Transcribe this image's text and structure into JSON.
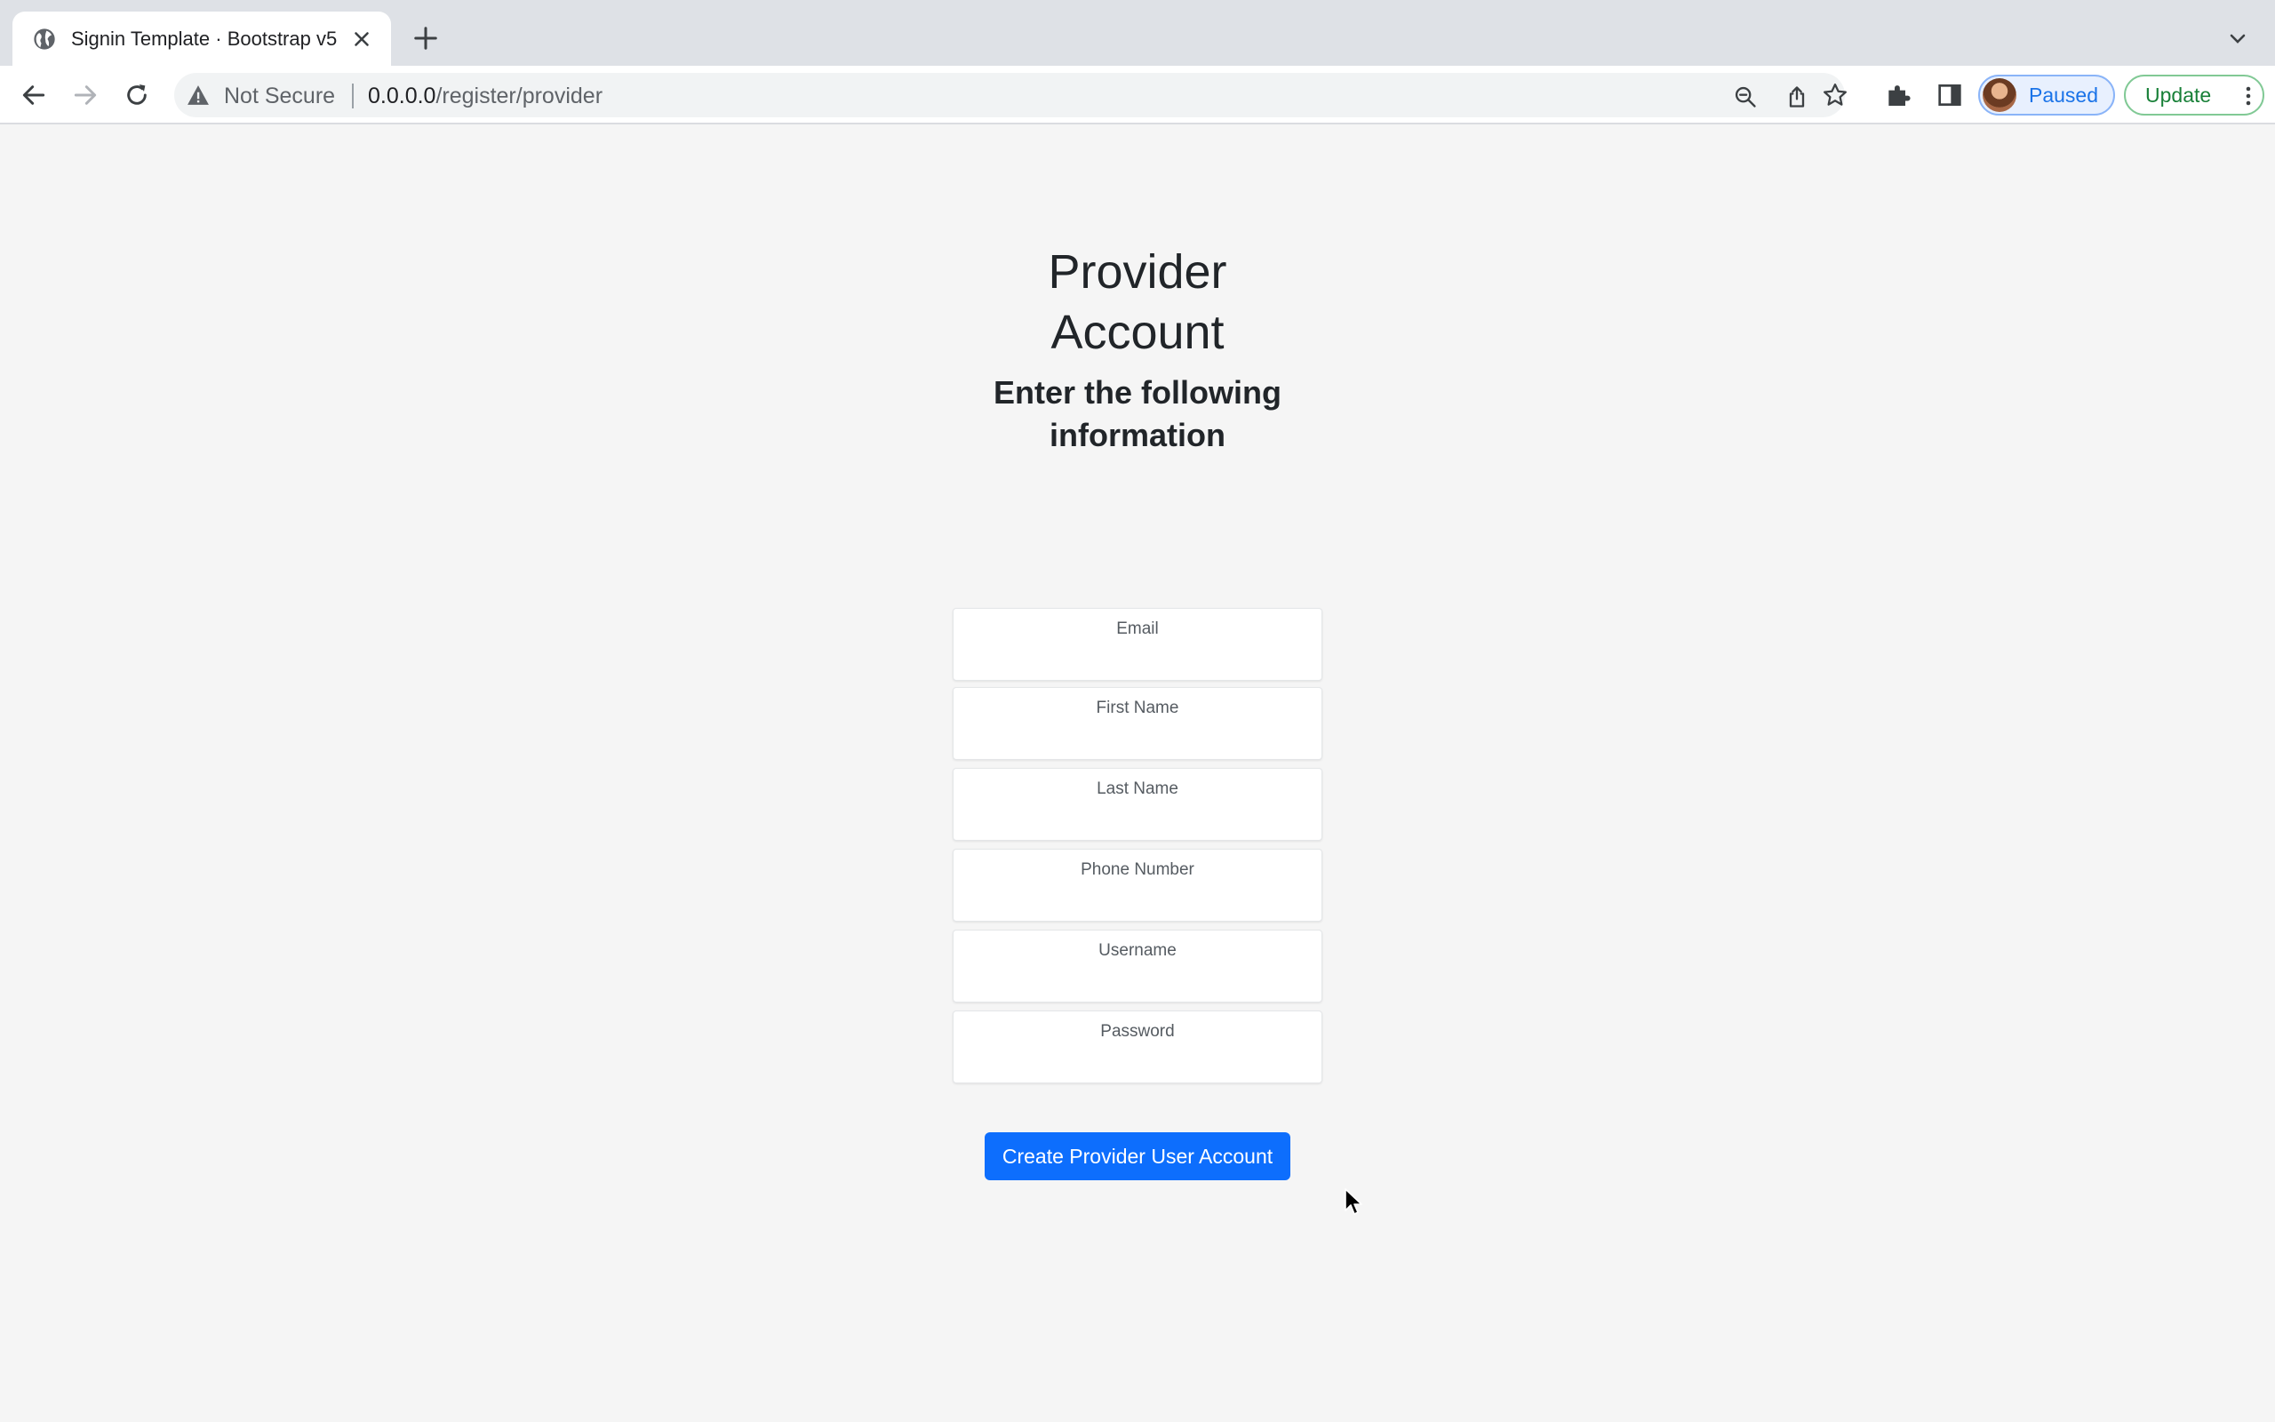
{
  "browser": {
    "tab_title": "Signin Template · Bootstrap v5",
    "security_label": "Not Secure",
    "url_host": "0.0.0.0",
    "url_path": "/register/provider",
    "profile_label": "Paused",
    "update_label": "Update"
  },
  "form": {
    "title_line1": "Provider",
    "title_line2": "Account",
    "subtitle_line1": "Enter the following",
    "subtitle_line2": "information",
    "fields": [
      {
        "label": "Email",
        "value": ""
      },
      {
        "label": "First Name",
        "value": ""
      },
      {
        "label": "Last Name",
        "value": ""
      },
      {
        "label": "Phone Number",
        "value": ""
      },
      {
        "label": "Username",
        "value": ""
      },
      {
        "label": "Password",
        "value": ""
      }
    ],
    "submit_label": "Create Provider User Account"
  },
  "colors": {
    "primary_button": "#0d6efd",
    "page_background": "#f5f5f5"
  }
}
